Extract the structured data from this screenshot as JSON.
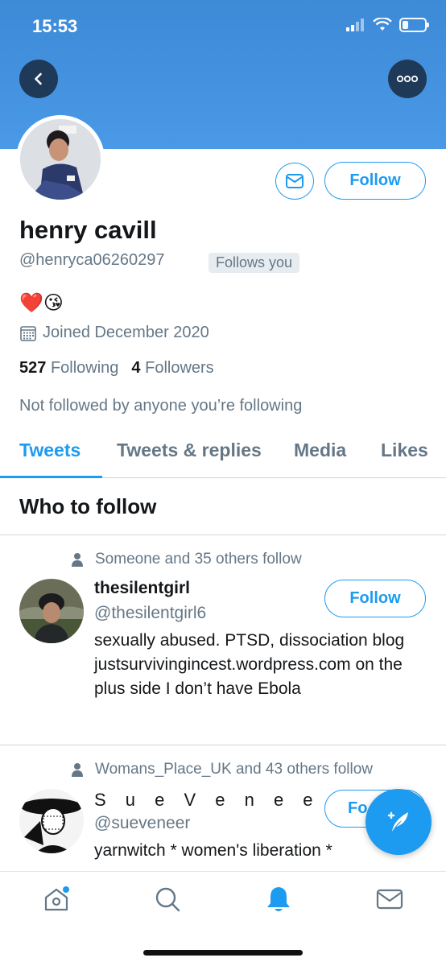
{
  "status_bar": {
    "time": "15:53"
  },
  "colors": {
    "accent": "#1d9bf0",
    "banner": "#4a99e6",
    "muted": "#657786",
    "text": "#14171a"
  },
  "header": {
    "back_icon": "chevron-left-icon",
    "more_icon": "more-horizontal-icon"
  },
  "profile": {
    "name": "henry cavill",
    "handle": "@henryca06260297",
    "follows_you": "Follows you",
    "bio": "❤️😘",
    "joined": "Joined December 2020",
    "following_count": "527",
    "following_label": "Following",
    "followers_count": "4",
    "followers_label": "Followers",
    "not_followed": "Not followed by anyone you’re following",
    "follow_label": "Follow",
    "message_icon": "mail-icon"
  },
  "tabs": [
    {
      "label": "Tweets",
      "active": true
    },
    {
      "label": "Tweets & replies",
      "active": false
    },
    {
      "label": "Media",
      "active": false
    },
    {
      "label": "Likes",
      "active": false
    }
  ],
  "who_to_follow": {
    "title": "Who to follow",
    "suggestions": [
      {
        "social_context": "Someone and 35 others follow",
        "name": "thesilentgirl",
        "handle": "@thesilentgirl6",
        "bio": "sexually abused. PTSD, dissociation blog justsurvivingincest.wordpress.com on the plus side I don’t have Ebola",
        "follow_label": "Follow"
      },
      {
        "social_context": "Womans_Place_UK and 43 others follow",
        "name": "S u e V e n e e r",
        "handle": "@sueveneer",
        "bio": "yarnwitch * women's liberation *",
        "follow_label": "Fo"
      }
    ]
  },
  "fab": {
    "icon": "compose-tweet-icon"
  },
  "bottom_nav": [
    {
      "name": "home",
      "icon": "home-icon",
      "badge": true
    },
    {
      "name": "search",
      "icon": "search-icon"
    },
    {
      "name": "notifications",
      "icon": "bell-icon",
      "active": true
    },
    {
      "name": "messages",
      "icon": "mail-icon"
    }
  ]
}
